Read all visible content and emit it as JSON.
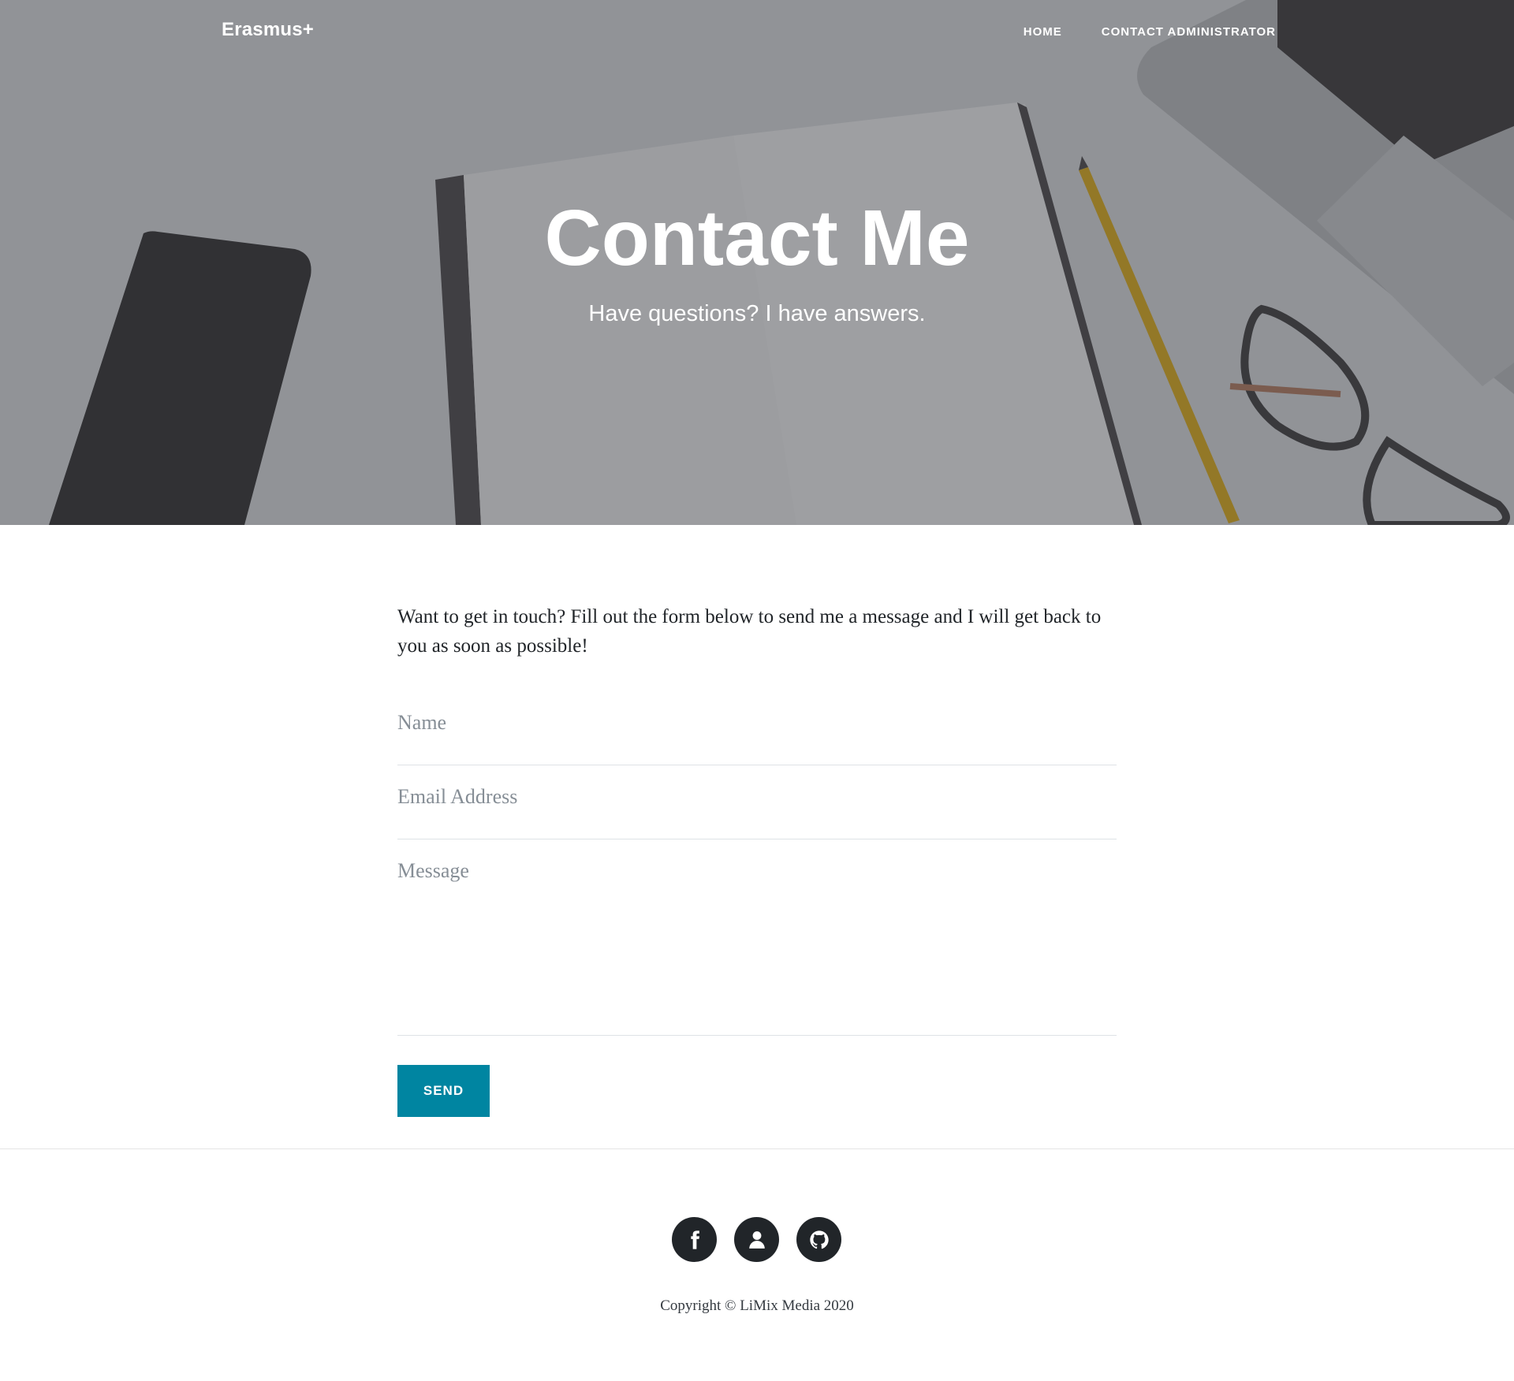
{
  "navbar": {
    "brand": "Erasmus+",
    "links": [
      {
        "label": "HOME"
      },
      {
        "label": "CONTACT ADMINISTRATOR"
      }
    ]
  },
  "hero": {
    "title": "Contact Me",
    "subtitle": "Have questions? I have answers."
  },
  "intro": "Want to get in touch? Fill out the form below to send me a message and I will get back to you as soon as possible!",
  "form": {
    "name_placeholder": "Name",
    "email_placeholder": "Email Address",
    "message_placeholder": "Message",
    "send_label": "SEND"
  },
  "footer": {
    "social_icons": [
      "facebook-icon",
      "user-icon",
      "github-icon"
    ],
    "copyright": "Copyright © LiMix Media 2020"
  },
  "colors": {
    "accent": "#0085a1",
    "dark": "#212529"
  }
}
